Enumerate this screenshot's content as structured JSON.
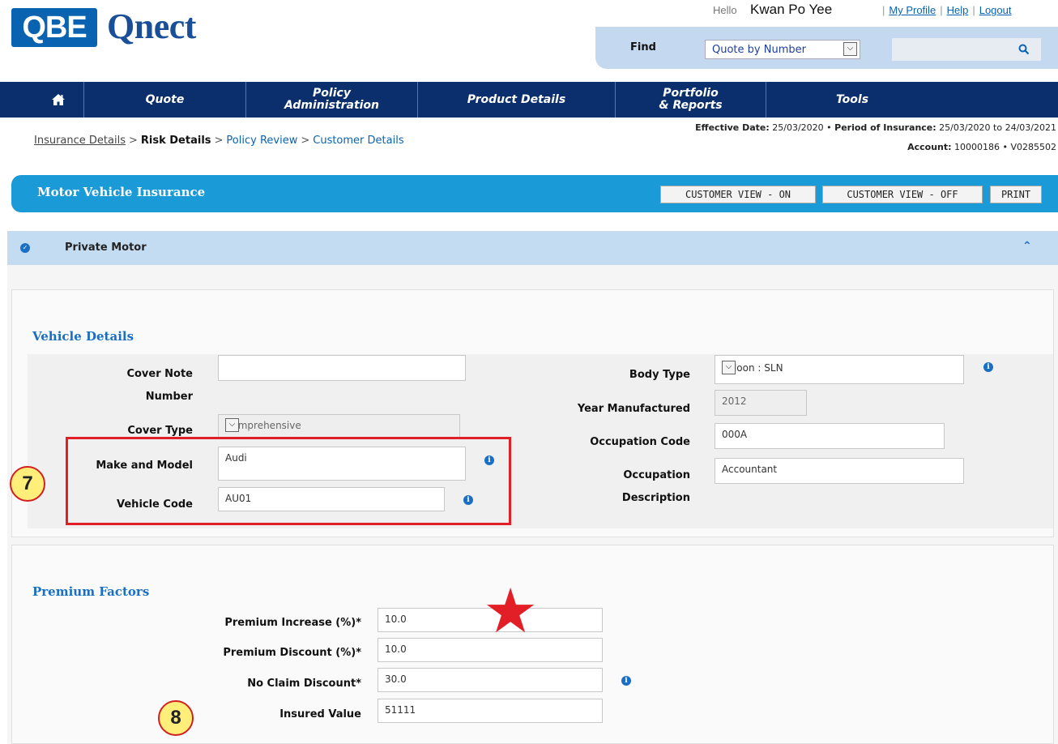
{
  "brand": {
    "logo_box": "QBE",
    "logo_text": "Qnect"
  },
  "user": {
    "hello": "Hello",
    "name": "Kwan Po Yee",
    "links": [
      "My Profile",
      "Help",
      "Logout"
    ]
  },
  "find": {
    "label": "Find",
    "selected": "Quote by Number",
    "search_value": ""
  },
  "nav": {
    "home_icon": "home-icon",
    "items": [
      {
        "line1": "Quote",
        "line2": ""
      },
      {
        "line1": "Policy",
        "line2": "Administration"
      },
      {
        "line1": "Product Details",
        "line2": ""
      },
      {
        "line1": "Portfolio",
        "line2": "& Reports"
      },
      {
        "line1": "Tools",
        "line2": ""
      }
    ]
  },
  "breadcrumb": [
    "Insurance Details",
    "Risk Details",
    "Policy Review",
    "Customer Details"
  ],
  "policy_info": {
    "effective_label": "Effective Date:",
    "effective_date": "25/03/2020",
    "period_label": "Period of Insurance:",
    "period_value": "25/03/2020 to 24/03/2021",
    "account_label": "Account:",
    "account_value": "10000186 • V0285502"
  },
  "insurance": {
    "title": "Motor Vehicle Insurance",
    "buttons": [
      "CUSTOMER VIEW - ON",
      "CUSTOMER VIEW - OFF",
      "PRINT"
    ]
  },
  "section": {
    "title": "Private Motor"
  },
  "vehicle_details": {
    "title": "Vehicle Details",
    "cover_note_label_1": "Cover Note",
    "cover_note_label_2": "Number",
    "cover_note_value": "",
    "cover_type_label": "Cover Type",
    "cover_type_value": "Comprehensive",
    "make_model_label": "Make and Model",
    "make_model_value": "Audi",
    "vehicle_code_label": "Vehicle Code",
    "vehicle_code_value": "AU01",
    "body_type_label": "Body Type",
    "body_type_value": "Saloon : SLN",
    "year_label": "Year Manufactured",
    "year_value": "2012",
    "occ_code_label": "Occupation Code",
    "occ_code_value": "000A",
    "occ_desc_label_1": "Occupation",
    "occ_desc_label_2": "Description",
    "occ_desc_value": "Accountant"
  },
  "premium_factors": {
    "title": "Premium Factors",
    "rows": [
      {
        "label": "Premium Increase (%)*",
        "value": "10.0"
      },
      {
        "label": "Premium Discount (%)*",
        "value": "10.0"
      },
      {
        "label": "No Claim Discount*",
        "value": "30.0"
      },
      {
        "label": "Insured Value",
        "value": "51111"
      }
    ]
  },
  "annotations": {
    "step_7": "7",
    "step_8": "8",
    "star_color": "#e21f26"
  },
  "colors": {
    "nav": "#0a2f6c",
    "accent": "#1a9ad6",
    "brand": "#0a63b0"
  }
}
